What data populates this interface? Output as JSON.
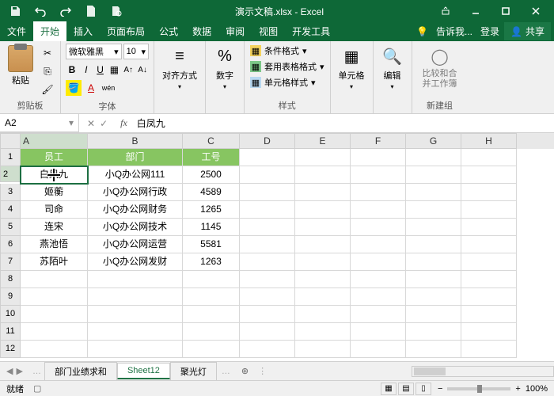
{
  "app": {
    "title": "演示文稿.xlsx - Excel"
  },
  "tabs": {
    "file": "文件",
    "home": "开始",
    "insert": "插入",
    "layout": "页面布局",
    "formula": "公式",
    "data": "数据",
    "review": "审阅",
    "view": "视图",
    "dev": "开发工具",
    "tell": "告诉我...",
    "login": "登录",
    "share": "共享"
  },
  "ribbon": {
    "clipboard": {
      "label": "剪贴板",
      "paste": "粘贴"
    },
    "font": {
      "label": "字体",
      "name": "微软雅黑",
      "size": "10",
      "bold": "B",
      "italic": "I",
      "underline": "U",
      "wen": "wén"
    },
    "align": {
      "label": "对齐方式"
    },
    "number": {
      "label": "数字"
    },
    "styles": {
      "label": "样式",
      "cond": "条件格式",
      "table": "套用表格格式",
      "cell": "单元格样式"
    },
    "cells": {
      "label": "单元格"
    },
    "edit": {
      "label": "编辑"
    },
    "compare": {
      "label": "新建组",
      "btn": "比较和合并工作簿"
    }
  },
  "namebox": "A2",
  "formula": "白凤九",
  "columns": [
    "A",
    "B",
    "C",
    "D",
    "E",
    "F",
    "G",
    "H"
  ],
  "header": {
    "emp": "员工",
    "dept": "部门",
    "id": "工号"
  },
  "rows": [
    {
      "emp": "白凤九",
      "dept": "小Q办公网111",
      "id": "2500"
    },
    {
      "emp": "姬蘅",
      "dept": "小Q办公网行政",
      "id": "4589"
    },
    {
      "emp": "司命",
      "dept": "小Q办公网财务",
      "id": "1265"
    },
    {
      "emp": "连宋",
      "dept": "小Q办公网技术",
      "id": "1145"
    },
    {
      "emp": "燕池悟",
      "dept": "小Q办公网运营",
      "id": "5581"
    },
    {
      "emp": "苏陌叶",
      "dept": "小Q办公网发财",
      "id": "1263"
    }
  ],
  "sheets": {
    "s1": "部门业绩求和",
    "s2": "Sheet12",
    "s3": "聚光灯"
  },
  "status": {
    "ready": "就绪",
    "rec": "",
    "zoom": "100%"
  }
}
